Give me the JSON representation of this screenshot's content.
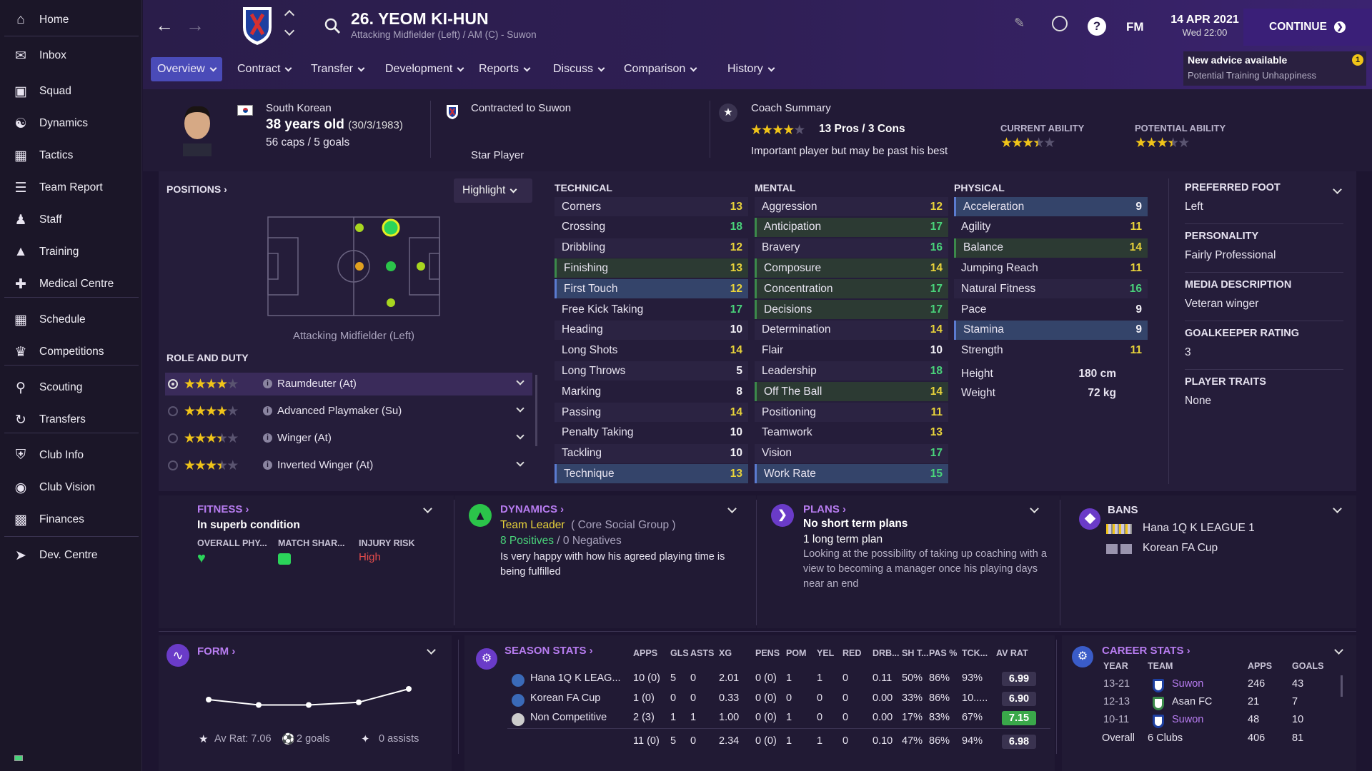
{
  "sidebar": {
    "items": [
      {
        "label": "Home",
        "icon": "home-icon"
      },
      {
        "label": "Inbox",
        "icon": "inbox-icon"
      },
      {
        "label": "Squad",
        "icon": "shirt-icon"
      },
      {
        "label": "Dynamics",
        "icon": "dynamics-icon"
      },
      {
        "label": "Tactics",
        "icon": "tactics-icon"
      },
      {
        "label": "Team Report",
        "icon": "report-icon"
      },
      {
        "label": "Staff",
        "icon": "staff-icon"
      },
      {
        "label": "Training",
        "icon": "training-icon"
      },
      {
        "label": "Medical Centre",
        "icon": "medical-icon"
      },
      {
        "label": "Schedule",
        "icon": "calendar-icon"
      },
      {
        "label": "Competitions",
        "icon": "trophy-icon"
      },
      {
        "label": "Scouting",
        "icon": "search-icon"
      },
      {
        "label": "Transfers",
        "icon": "transfer-icon"
      },
      {
        "label": "Club Info",
        "icon": "shield-icon"
      },
      {
        "label": "Club Vision",
        "icon": "vision-icon"
      },
      {
        "label": "Finances",
        "icon": "finances-icon"
      },
      {
        "label": "Dev. Centre",
        "icon": "dev-icon"
      }
    ]
  },
  "header": {
    "player_title": "26. YEOM KI-HUN",
    "player_subtitle": "Attacking Midfielder (Left) / AM (C) - Suwon",
    "fm": "FM",
    "date": "14 APR 2021",
    "time": "Wed 22:00",
    "continue": "CONTINUE",
    "advice_title": "New advice available",
    "advice_sub": "Potential Training Unhappiness",
    "advice_count": "1"
  },
  "tabs": [
    "Overview",
    "Contract",
    "Transfer",
    "Development",
    "Reports",
    "Discuss",
    "Comparison",
    "History"
  ],
  "profile": {
    "nationality": "South Korean",
    "age": "38 years old",
    "dob": "(30/3/1983)",
    "caps": "56 caps / 5 goals",
    "contract": "Contracted to Suwon",
    "status": "Star Player",
    "coach_title": "Coach Summary",
    "pros_cons": "13 Pros / 3 Cons",
    "coach_text": "Important player but may be past his best",
    "ca_label": "CURRENT ABILITY",
    "pa_label": "POTENTIAL ABILITY",
    "coach_stars": 4,
    "ca_stars": 3.5,
    "pa_stars": 3.5
  },
  "positions": {
    "title": "POSITIONS",
    "highlight": "Highlight",
    "pos_label": "Attacking Midfielder (Left)",
    "role_title": "ROLE AND DUTY",
    "roles": [
      {
        "name": "Raumdeuter (At)",
        "stars": 4
      },
      {
        "name": "Advanced Playmaker (Su)",
        "stars": 4
      },
      {
        "name": "Winger (At)",
        "stars": 3.5
      },
      {
        "name": "Inverted Winger (At)",
        "stars": 3.5
      }
    ]
  },
  "technical": {
    "title": "TECHNICAL",
    "attrs": [
      [
        "Corners",
        "13"
      ],
      [
        "Crossing",
        "18"
      ],
      [
        "Dribbling",
        "12"
      ],
      [
        "Finishing",
        "13"
      ],
      [
        "First Touch",
        "12"
      ],
      [
        "Free Kick Taking",
        "17"
      ],
      [
        "Heading",
        "10"
      ],
      [
        "Long Shots",
        "14"
      ],
      [
        "Long Throws",
        "5"
      ],
      [
        "Marking",
        "8"
      ],
      [
        "Passing",
        "14"
      ],
      [
        "Penalty Taking",
        "10"
      ],
      [
        "Tackling",
        "10"
      ],
      [
        "Technique",
        "13"
      ]
    ]
  },
  "mental": {
    "title": "MENTAL",
    "attrs": [
      [
        "Aggression",
        "12"
      ],
      [
        "Anticipation",
        "17"
      ],
      [
        "Bravery",
        "16"
      ],
      [
        "Composure",
        "14"
      ],
      [
        "Concentration",
        "17"
      ],
      [
        "Decisions",
        "17"
      ],
      [
        "Determination",
        "14"
      ],
      [
        "Flair",
        "10"
      ],
      [
        "Leadership",
        "18"
      ],
      [
        "Off The Ball",
        "14"
      ],
      [
        "Positioning",
        "11"
      ],
      [
        "Teamwork",
        "13"
      ],
      [
        "Vision",
        "17"
      ],
      [
        "Work Rate",
        "15"
      ]
    ]
  },
  "physical": {
    "title": "PHYSICAL",
    "attrs": [
      [
        "Acceleration",
        "9"
      ],
      [
        "Agility",
        "11"
      ],
      [
        "Balance",
        "14"
      ],
      [
        "Jumping Reach",
        "11"
      ],
      [
        "Natural Fitness",
        "16"
      ],
      [
        "Pace",
        "9"
      ],
      [
        "Stamina",
        "9"
      ],
      [
        "Strength",
        "11"
      ]
    ],
    "height_label": "Height",
    "height": "180 cm",
    "weight_label": "Weight",
    "weight": "72 kg"
  },
  "info": {
    "foot_label": "PREFERRED FOOT",
    "foot": "Left",
    "personality_label": "PERSONALITY",
    "personality": "Fairly Professional",
    "media_label": "MEDIA DESCRIPTION",
    "media": "Veteran winger",
    "gk_label": "GOALKEEPER RATING",
    "gk": "3",
    "traits_label": "PLAYER TRAITS",
    "traits": "None"
  },
  "fitness": {
    "title": "FITNESS",
    "status": "In superb condition",
    "c1": "OVERALL PHY...",
    "c2": "MATCH SHAR...",
    "c3": "INJURY RISK",
    "risk": "High"
  },
  "dynamics": {
    "title": "DYNAMICS",
    "role": "Team Leader",
    "group": "( Core Social Group )",
    "positives": "8 Positives",
    "slash": "/",
    "negatives": "0 Negatives",
    "text": "Is very happy with how his agreed playing time is being fulfilled"
  },
  "plans": {
    "title": "PLANS",
    "short": "No short term plans",
    "long": "1 long term plan",
    "text": "Looking at the possibility of taking up coaching with a view to becoming a manager once his playing days near an end"
  },
  "bans": {
    "title": "BANS",
    "items": [
      "Hana 1Q K LEAGUE 1",
      "Korean FA Cup"
    ]
  },
  "form": {
    "title": "FORM",
    "ratings": [
      6.9,
      6.8,
      6.8,
      6.85,
      7.1
    ],
    "avrat": "Av Rat: 7.06",
    "goals": "2 goals",
    "assists": "0 assists"
  },
  "season": {
    "title": "SEASON STATS",
    "headers": [
      "APPS",
      "GLS",
      "ASTS",
      "XG",
      "PENS",
      "POM",
      "YEL",
      "RED",
      "DRB...",
      "SH T...",
      "PAS %",
      "TCK...",
      "AV RAT"
    ],
    "rows": [
      [
        "Hana 1Q K LEAG...",
        "10 (0)",
        "5",
        "0",
        "2.01",
        "0 (0)",
        "1",
        "1",
        "0",
        "0.11",
        "50%",
        "86%",
        "93%",
        "6.99"
      ],
      [
        "Korean FA Cup",
        "1 (0)",
        "0",
        "0",
        "0.33",
        "0 (0)",
        "0",
        "0",
        "0",
        "0.00",
        "33%",
        "86%",
        "10.....",
        "6.90"
      ],
      [
        "Non Competitive",
        "2 (3)",
        "1",
        "1",
        "1.00",
        "0 (0)",
        "1",
        "0",
        "0",
        "0.00",
        "17%",
        "83%",
        "67%",
        "7.15"
      ]
    ],
    "total": [
      "",
      "11 (0)",
      "5",
      "0",
      "2.34",
      "0 (0)",
      "1",
      "1",
      "0",
      "0.10",
      "47%",
      "86%",
      "94%",
      "6.98"
    ]
  },
  "career": {
    "title": "CAREER STATS",
    "headers": [
      "YEAR",
      "TEAM",
      "APPS",
      "GOALS"
    ],
    "rows": [
      [
        "13-21",
        "Suwon",
        "246",
        "43"
      ],
      [
        "12-13",
        "Asan FC",
        "21",
        "7"
      ],
      [
        "10-11",
        "Suwon",
        "48",
        "10"
      ]
    ],
    "overall": [
      "Overall",
      "6 Clubs",
      "406",
      "81"
    ]
  },
  "colors": {
    "accent": "#4a4bb8",
    "green": "#49d37a",
    "yellow": "#e8d33a",
    "risk": "#e34b4b",
    "purple": "#b77cf0"
  }
}
